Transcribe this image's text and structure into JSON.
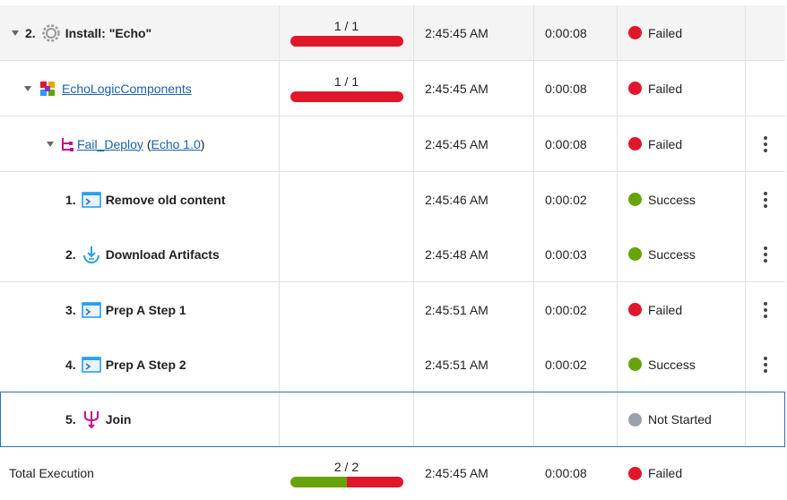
{
  "rows": [
    {
      "caret": true,
      "num": "2.",
      "icon": "gear-icon",
      "label": "Install: \"Echo\"",
      "progress_label": "1 / 1",
      "progress": {
        "success": 0,
        "failed": 1
      },
      "start": "2:45:45 AM",
      "duration": "0:00:08",
      "status": "Failed"
    },
    {
      "caret": true,
      "icon": "components-icon",
      "label": "EchoLogicComponents",
      "progress_label": "1 / 1",
      "progress": {
        "success": 0,
        "failed": 1
      },
      "start": "2:45:45 AM",
      "duration": "0:00:08",
      "status": "Failed"
    },
    {
      "caret": true,
      "icon": "process-icon",
      "label": "Fail_Deploy",
      "version": "Echo 1.0",
      "start": "2:45:45 AM",
      "duration": "0:00:08",
      "status": "Failed"
    },
    {
      "num": "1.",
      "icon": "shell-icon",
      "label": "Remove old content",
      "start": "2:45:46 AM",
      "duration": "0:00:02",
      "status": "Success"
    },
    {
      "num": "2.",
      "icon": "download-icon",
      "label": "Download Artifacts",
      "start": "2:45:48 AM",
      "duration": "0:00:03",
      "status": "Success"
    },
    {
      "num": "3.",
      "icon": "shell-icon",
      "label": "Prep A Step 1",
      "start": "2:45:51 AM",
      "duration": "0:00:02",
      "status": "Failed"
    },
    {
      "num": "4.",
      "icon": "shell-icon",
      "label": "Prep A Step 2",
      "start": "2:45:51 AM",
      "duration": "0:00:02",
      "status": "Success"
    },
    {
      "num": "5.",
      "icon": "join-icon",
      "label": "Join",
      "status": "Not Started"
    }
  ],
  "total": {
    "label": "Total Execution",
    "progress_label": "2 / 2",
    "progress": {
      "success": 1,
      "failed": 1
    },
    "start": "2:45:45 AM",
    "duration": "0:00:08",
    "status": "Failed"
  }
}
